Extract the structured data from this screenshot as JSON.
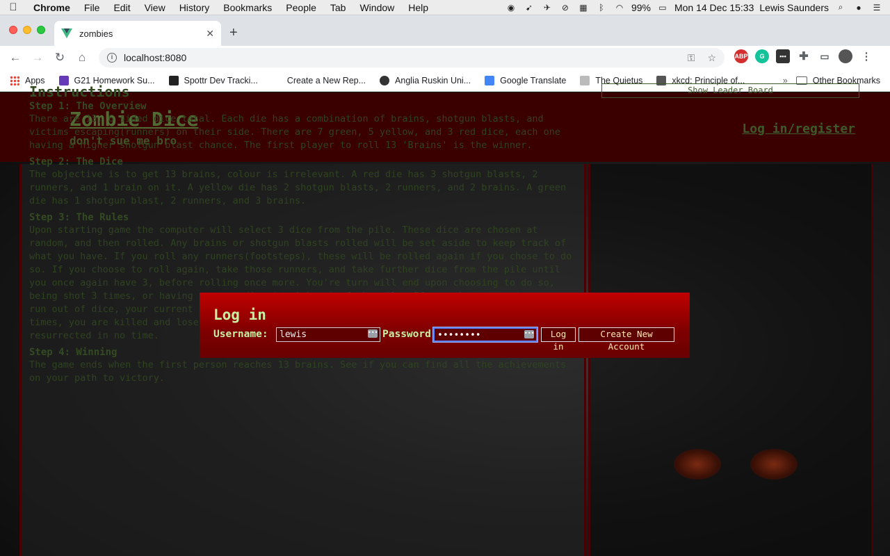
{
  "menubar": {
    "items": [
      "Chrome",
      "File",
      "Edit",
      "View",
      "History",
      "Bookmarks",
      "People",
      "Tab",
      "Window",
      "Help"
    ],
    "battery": "99%",
    "datetime": "Mon 14 Dec  15:33",
    "user": "Lewis Saunders"
  },
  "tab": {
    "title": "zombies",
    "close": "✕",
    "new_tab": "+"
  },
  "toolbar": {
    "url": "localhost:8080",
    "back": "←",
    "forward": "→",
    "reload": "↻",
    "home": "⌂"
  },
  "bookmarks": {
    "items": [
      {
        "label": "Apps",
        "color": "#4285f4"
      },
      {
        "label": "G21 Homework Su...",
        "color": "#673ab7"
      },
      {
        "label": "Spottr Dev Tracki...",
        "color": "#222222"
      },
      {
        "label": "Create a New Rep...",
        "color": "#ffffff"
      },
      {
        "label": "Anglia Ruskin Uni...",
        "color": "#333333"
      },
      {
        "label": "Google Translate",
        "color": "#4285f4"
      },
      {
        "label": "The Quietus",
        "color": "#888888"
      },
      {
        "label": "xkcd: Principle of...",
        "color": "#555555"
      }
    ],
    "more": "»",
    "other": "Other Bookmarks"
  },
  "site": {
    "title": "Zombie Dice",
    "tagline": "don't sue me bro",
    "login_link": "Log in/register",
    "leaderboard_button": "Show Leader Board"
  },
  "instructions": {
    "heading": "Instructions",
    "steps": [
      {
        "title": "Step 1: The Overview",
        "body": "There are 13, 6 sided dice total. Each die has a combination of brains, shotgun blasts, and victims escaping(runners) on their side. There are 7 green, 5 yellow, and 3 red dice, each one having a higher shotgun blast chance. The first player to roll 13 'Brains' is the winner."
      },
      {
        "title": "Step 2: The Dice",
        "body": "The objective is to get 13 brains, colour is irrelevant. A red die has 3 shotgun blasts, 2 runners, and 1 brain on it. A yellow die has 2 shotgun blasts, 2 runners, and 2 brains. A green die has 1 shotgun blast, 2 runners, and 3 brains."
      },
      {
        "title": "Step 3: The Rules",
        "body": "Upon starting game the computer will select 3 dice from the pile. These dice are chosen at random, and then rolled. Any brains or shotgun blasts rolled will be set aside to keep track of what you have. If you roll any runners(footsteps), these will be rolled again if you chose to do so. If you choose to roll again, take those runners, and take further dice from the pile until you once again have 3, before rolling once more. You're turn will end upon choosing to do so, being shot 3 times, or having no more dice to pick out of the pile. If you choose to stop or you run out of dice, your current brains will be added to your running total. If you are shot 3 times, you are killed and lose all brains for this round. Luckily you're a zombie so you'll be resurrected in no time."
      },
      {
        "title": "Step 4: Winning",
        "body": "The game ends when the first person reaches 13 brains. See if you can find all the achievements on your path to victory."
      }
    ]
  },
  "login_modal": {
    "title": "Log in",
    "username_label": "Username:",
    "username_value": "lewis",
    "password_label": "Password",
    "password_value": "••••••••",
    "login_button": "Log in",
    "create_button": "Create New Account"
  }
}
